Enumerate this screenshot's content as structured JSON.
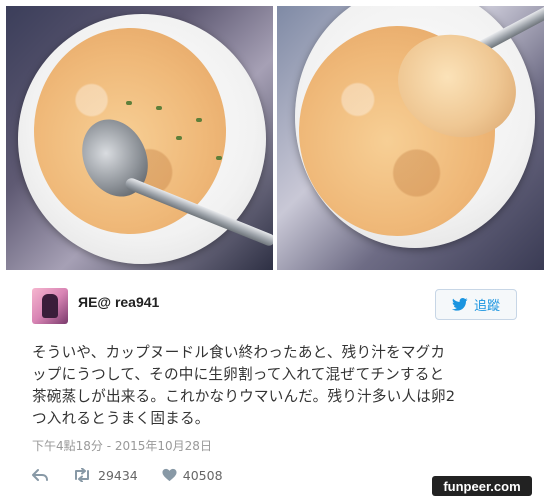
{
  "photos": [
    {
      "name": "left-photo"
    },
    {
      "name": "right-photo"
    }
  ],
  "tweet": {
    "user_name": "ЯE@ rea941",
    "follow_label": "追蹤",
    "text_lines": [
      "そういや、カップヌードル食い終わったあと、残り汁をマグカ",
      "ップにうつして、その中に生卵割って入れて混ぜてチンすると",
      "茶碗蒸しが出来る。これかなりウマいんだ。残り汁多い人は卵2",
      "つ入れるとうまく固まる。"
    ],
    "timestamp": "下午4點18分 - 2015年10月28日",
    "retweet_count": "29434",
    "like_count": "40508"
  },
  "colors": {
    "accent": "#1b95e0",
    "text": "#333333",
    "muted": "#999999"
  },
  "icons": [
    "reply-icon",
    "retweet-icon",
    "heart-icon",
    "twitter-bird-icon"
  ],
  "watermark": "funpeer.com"
}
